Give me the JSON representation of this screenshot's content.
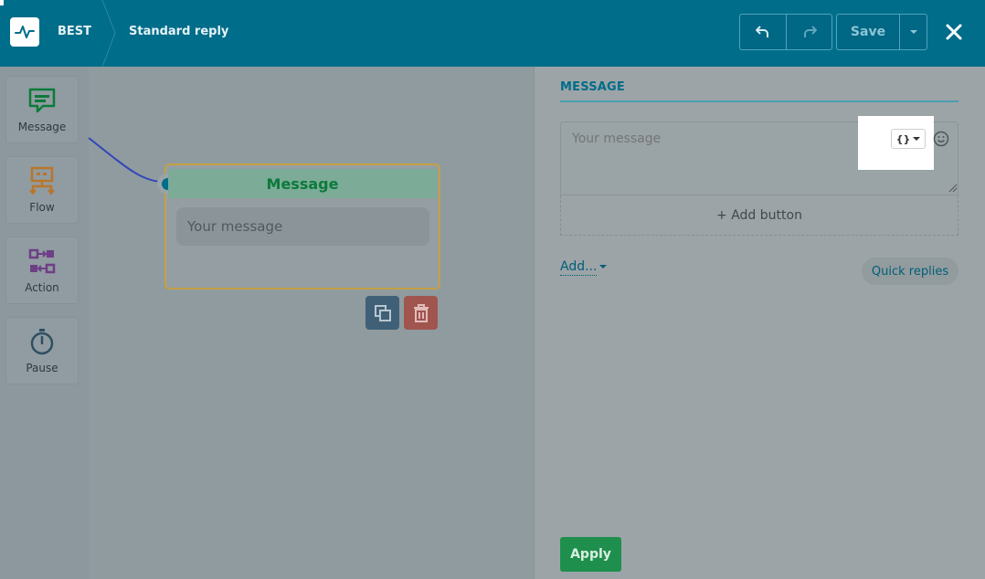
{
  "header": {
    "bot_name": "BEST",
    "flow_name": "Standard reply",
    "save_label": "Save",
    "icons": {
      "logo": "pulse-logo-icon",
      "undo": "undo-icon",
      "redo": "redo-icon",
      "save_menu": "chevron-down-icon",
      "close": "close-icon"
    }
  },
  "sidebar": {
    "items": [
      {
        "label": "Message",
        "icon": "message-icon",
        "color": "#0c7a3b"
      },
      {
        "label": "Flow",
        "icon": "flow-icon",
        "color": "#b8762a"
      },
      {
        "label": "Action",
        "icon": "action-icon",
        "color": "#6e3f86"
      },
      {
        "label": "Pause",
        "icon": "stopwatch-icon",
        "color": "#2e4f62"
      }
    ]
  },
  "canvas": {
    "node": {
      "title": "Message",
      "placeholder": "Your message"
    }
  },
  "panel": {
    "tab_label": "MESSAGE",
    "message_placeholder": "Your message",
    "variable_button_label": "{}",
    "add_button_label": "+ Add button",
    "add_menu_label": "Add...",
    "quick_replies_label": "Quick replies",
    "apply_label": "Apply"
  },
  "colors": {
    "header_bg": "#006d8a",
    "accent": "#006d8a",
    "apply_green": "#1f8f4e",
    "node_border": "#c4a046"
  }
}
